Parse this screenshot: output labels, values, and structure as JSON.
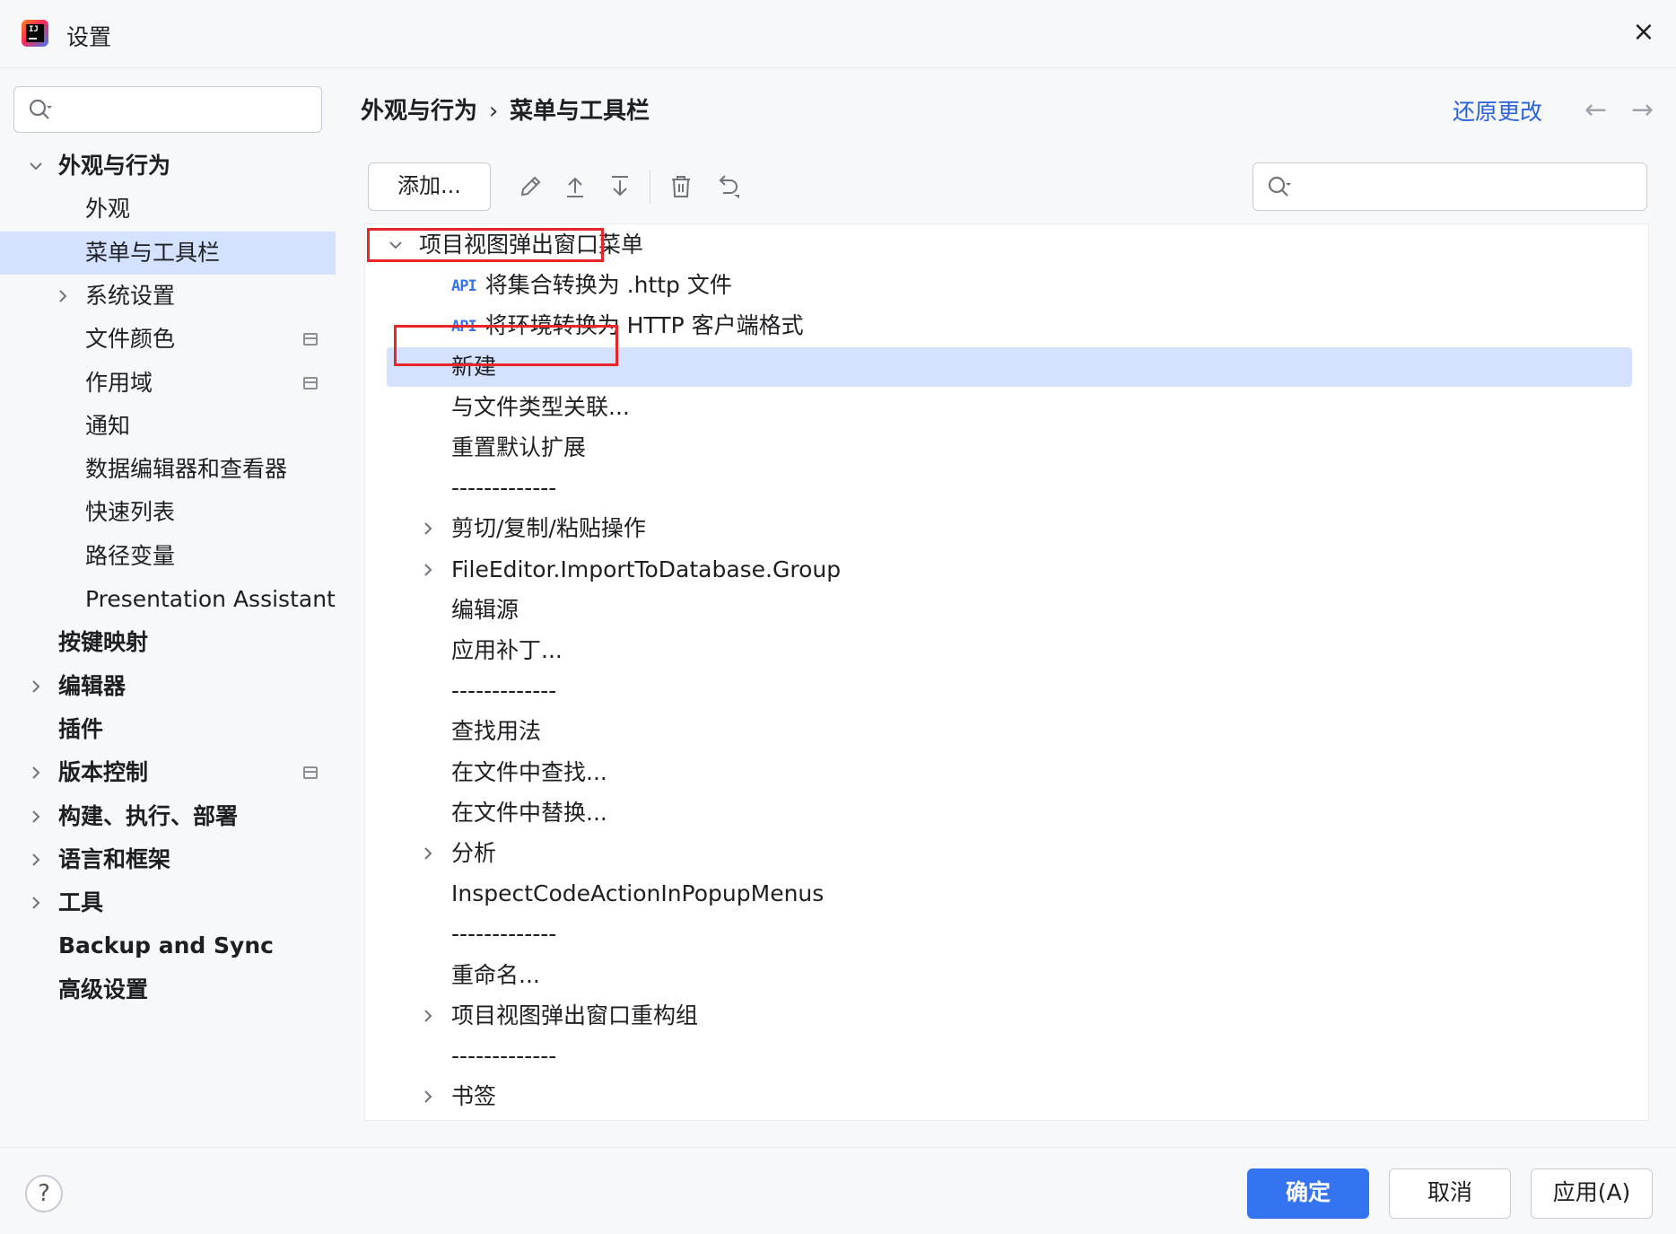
{
  "window": {
    "title": "设置",
    "close_icon": "×"
  },
  "sidebar": {
    "search_placeholder": "",
    "items": [
      {
        "label": "外观与行为",
        "level": 0,
        "expanded": true,
        "bold": true
      },
      {
        "label": "外观",
        "level": 1
      },
      {
        "label": "菜单与工具栏",
        "level": 1,
        "selected": true
      },
      {
        "label": "系统设置",
        "level": 1,
        "collapsed": true
      },
      {
        "label": "文件颜色",
        "level": 1,
        "badge": true
      },
      {
        "label": "作用域",
        "level": 1,
        "badge": true
      },
      {
        "label": "通知",
        "level": 1
      },
      {
        "label": "数据编辑器和查看器",
        "level": 1
      },
      {
        "label": "快速列表",
        "level": 1
      },
      {
        "label": "路径变量",
        "level": 1
      },
      {
        "label": "Presentation Assistant",
        "level": 1
      },
      {
        "label": "按键映射",
        "level": 0,
        "bold": true
      },
      {
        "label": "编辑器",
        "level": 0,
        "bold": true,
        "collapsed": true
      },
      {
        "label": "插件",
        "level": 0,
        "bold": true
      },
      {
        "label": "版本控制",
        "level": 0,
        "bold": true,
        "collapsed": true,
        "badge": true
      },
      {
        "label": "构建、执行、部署",
        "level": 0,
        "bold": true,
        "collapsed": true
      },
      {
        "label": "语言和框架",
        "level": 0,
        "bold": true,
        "collapsed": true
      },
      {
        "label": "工具",
        "level": 0,
        "bold": true,
        "collapsed": true
      },
      {
        "label": "Backup and Sync",
        "level": 0,
        "bold": true
      },
      {
        "label": "高级设置",
        "level": 0,
        "bold": true
      }
    ]
  },
  "header": {
    "breadcrumb": [
      "外观与行为",
      "菜单与工具栏"
    ],
    "breadcrumb_sep": "›",
    "revert_label": "还原更改",
    "back_arrow": "←",
    "forward_arrow": "→"
  },
  "toolbar": {
    "add_label": "添加...",
    "icons": [
      "edit-icon",
      "move-up-icon",
      "move-down-icon",
      "delete-icon",
      "restore-icon"
    ]
  },
  "action_tree": [
    {
      "label": "项目视图弹出窗口菜单",
      "level": 0,
      "expanded": true,
      "highlight": true
    },
    {
      "label": "将集合转换为 .http 文件",
      "level": 2,
      "api": true
    },
    {
      "label": "将环境转换为 HTTP 客户端格式",
      "level": 2,
      "api": true
    },
    {
      "label": "新建",
      "level": 2,
      "selected": true,
      "highlight": true
    },
    {
      "label": "与文件类型关联...",
      "level": 2
    },
    {
      "label": "重置默认扩展",
      "level": 2
    },
    {
      "label": "-------------",
      "level": 2
    },
    {
      "label": "剪切/复制/粘贴操作",
      "level": 2,
      "collapsed": true
    },
    {
      "label": "FileEditor.ImportToDatabase.Group",
      "level": 2,
      "collapsed": true
    },
    {
      "label": "编辑源",
      "level": 2
    },
    {
      "label": "应用补丁...",
      "level": 2
    },
    {
      "label": "-------------",
      "level": 2
    },
    {
      "label": "查找用法",
      "level": 2
    },
    {
      "label": "在文件中查找...",
      "level": 2
    },
    {
      "label": "在文件中替换...",
      "level": 2
    },
    {
      "label": "分析",
      "level": 2,
      "collapsed": true
    },
    {
      "label": "InspectCodeActionInPopupMenus",
      "level": 2
    },
    {
      "label": "-------------",
      "level": 2
    },
    {
      "label": "重命名...",
      "level": 2
    },
    {
      "label": "项目视图弹出窗口重构组",
      "level": 2,
      "collapsed": true
    },
    {
      "label": "-------------",
      "level": 2
    },
    {
      "label": "书签",
      "level": 2,
      "collapsed": true
    }
  ],
  "api_tag": "API",
  "footer": {
    "help_label": "?",
    "ok_label": "确定",
    "cancel_label": "取消",
    "apply_label": "应用(A)"
  },
  "colors": {
    "accent": "#3574f0",
    "selection": "#d4e2ff",
    "highlight_box": "#e8262a",
    "link": "#2a62d9"
  }
}
